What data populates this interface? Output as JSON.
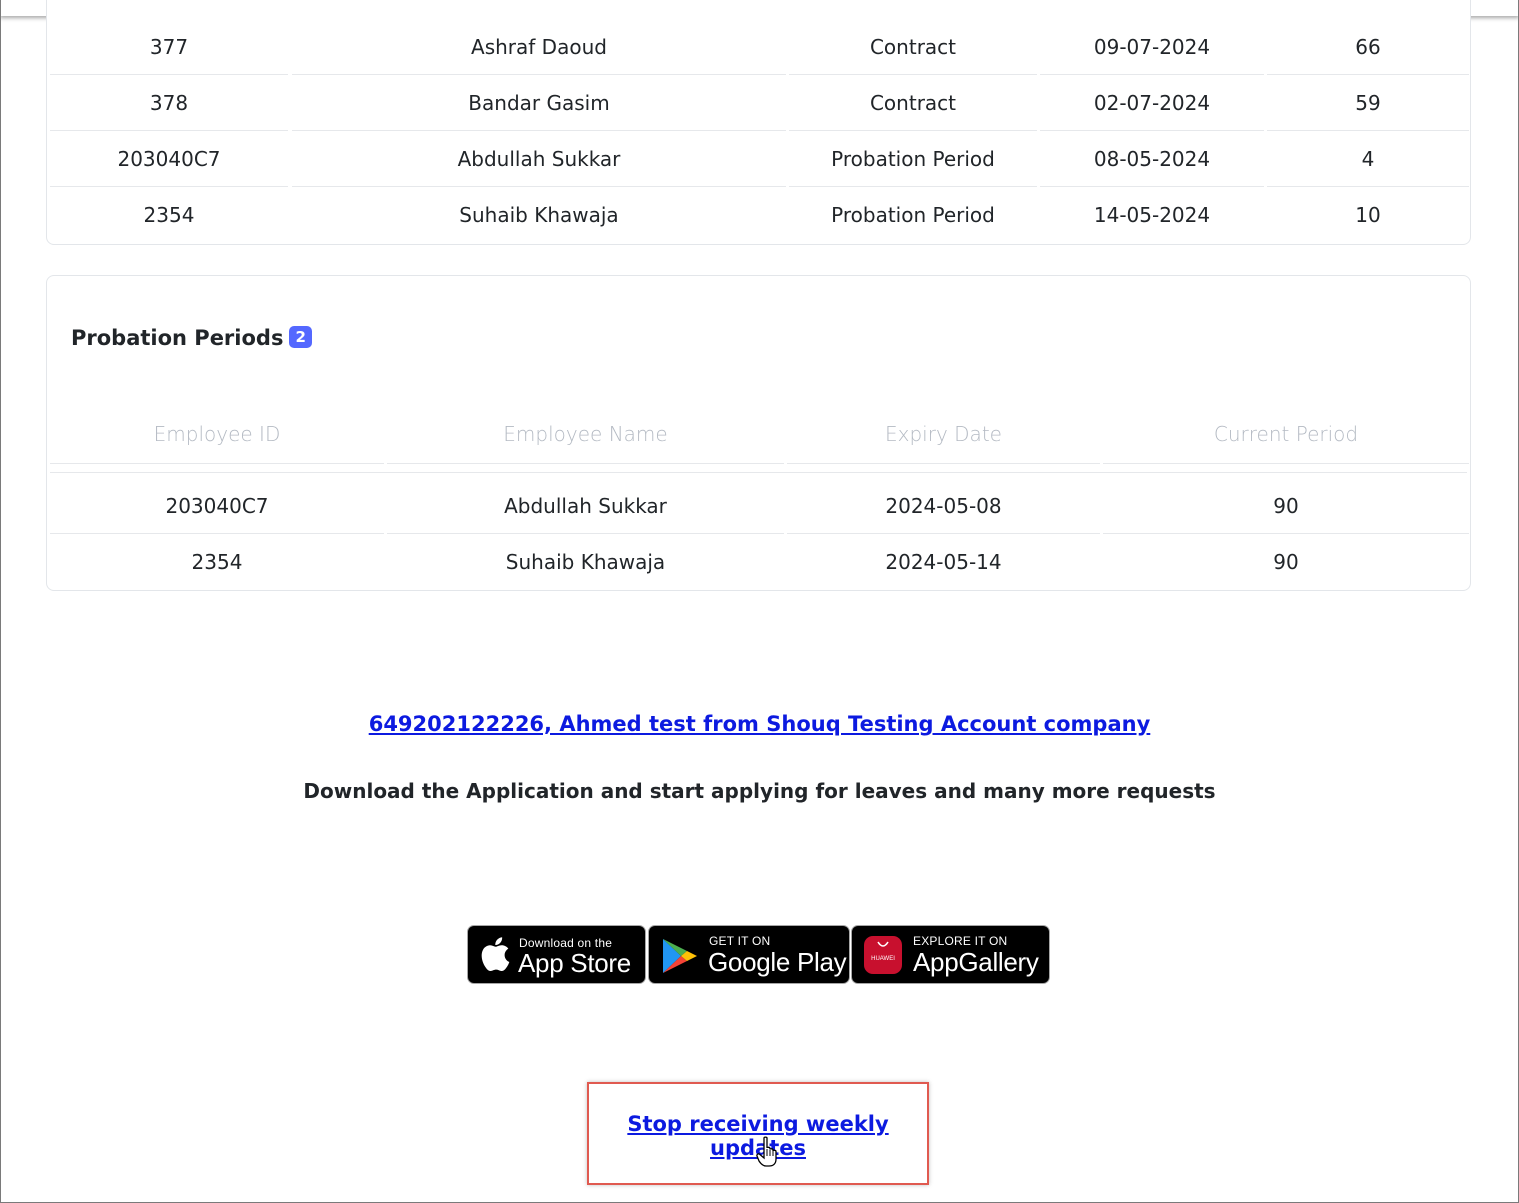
{
  "top_table": {
    "rows": [
      {
        "id": "377",
        "name": "Ashraf Daoud",
        "type": "Contract",
        "date": "09-07-2024",
        "days": "66"
      },
      {
        "id": "378",
        "name": "Bandar Gasim",
        "type": "Contract",
        "date": "02-07-2024",
        "days": "59"
      },
      {
        "id": "203040C7",
        "name": "Abdullah Sukkar",
        "type": "Probation Period",
        "date": "08-05-2024",
        "days": "4"
      },
      {
        "id": "2354",
        "name": "Suhaib Khawaja",
        "type": "Probation Period",
        "date": "14-05-2024",
        "days": "10"
      }
    ]
  },
  "probation": {
    "title": "Probation Periods",
    "count": "2",
    "headers": [
      "Employee ID",
      "Employee Name",
      "Expiry Date",
      "Current Period"
    ],
    "rows": [
      {
        "id": "203040C7",
        "name": "Abdullah Sukkar",
        "expiry": "2024-05-08",
        "period": "90"
      },
      {
        "id": "2354",
        "name": "Suhaib Khawaja",
        "expiry": "2024-05-14",
        "period": "90"
      }
    ]
  },
  "footer": {
    "company_link": "649202122226, Ahmed test from Shouq Testing Account company",
    "download_text": "Download the Application and start applying for leaves and many more requests",
    "app_store": {
      "small": "Download on the",
      "big": "App Store"
    },
    "google_play": {
      "small": "GET IT ON",
      "big": "Google Play"
    },
    "app_gallery": {
      "small": "EXPLORE IT ON",
      "big": "AppGallery",
      "logo_text": "HUAWEI"
    },
    "unsubscribe": "Stop receiving weekly updates"
  },
  "colors": {
    "link": "#0c1ae0",
    "badge": "#5468ff",
    "highlight_border": "#e05a50"
  }
}
